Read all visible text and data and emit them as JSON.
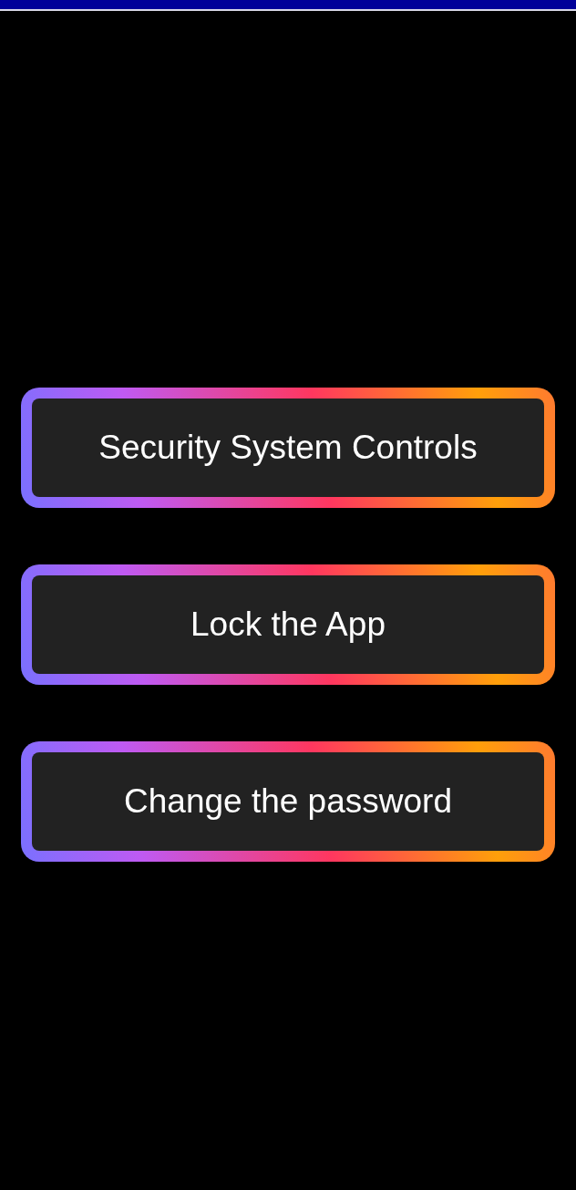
{
  "buttons": [
    {
      "label": "Security System Controls"
    },
    {
      "label": "Lock the App"
    },
    {
      "label": "Change the password"
    }
  ]
}
